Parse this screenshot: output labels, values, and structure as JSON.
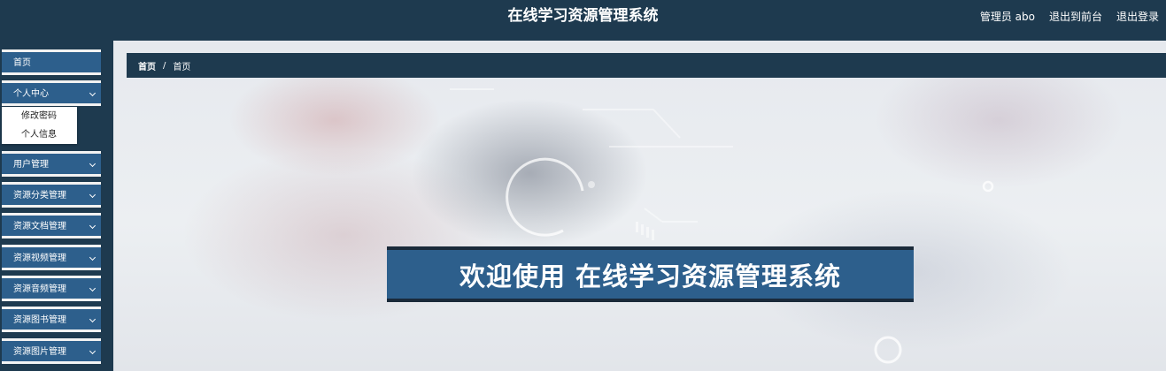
{
  "header": {
    "title": "在线学习资源管理系统",
    "user_label": "管理员 abo",
    "front_link": "退出到前台",
    "logout_link": "退出登录"
  },
  "sidebar": {
    "items": [
      {
        "label": "首页",
        "has_chevron": false
      },
      {
        "label": "个人中心",
        "has_chevron": true,
        "expanded": true,
        "children": [
          "修改密码",
          "个人信息"
        ]
      },
      {
        "label": "用户管理",
        "has_chevron": true
      },
      {
        "label": "资源分类管理",
        "has_chevron": true
      },
      {
        "label": "资源文档管理",
        "has_chevron": true
      },
      {
        "label": "资源视频管理",
        "has_chevron": true
      },
      {
        "label": "资源音频管理",
        "has_chevron": true
      },
      {
        "label": "资源图书管理",
        "has_chevron": true
      },
      {
        "label": "资源图片管理",
        "has_chevron": true
      }
    ]
  },
  "breadcrumb": {
    "root": "首页",
    "separator": "/",
    "current": "首页"
  },
  "main": {
    "welcome": "欢迎使用 在线学习资源管理系统"
  },
  "colors": {
    "header_bg": "#1e3a4f",
    "menu_item_bg": "#2d5f8c",
    "welcome_bg": "#2d5f8c"
  }
}
